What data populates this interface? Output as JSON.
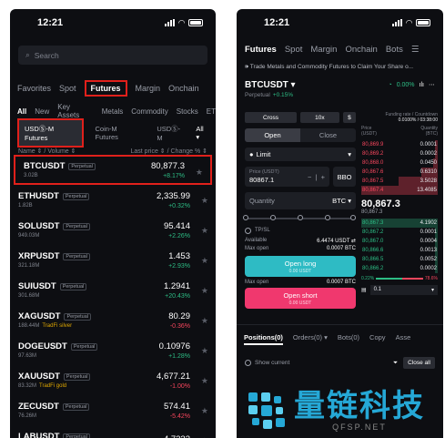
{
  "left": {
    "time": "12:21",
    "search_placeholder": "Search",
    "tabs": [
      "Favorites",
      "Spot",
      "Futures",
      "Margin",
      "Onchain"
    ],
    "subtabs": [
      "All",
      "New",
      "Key Assets",
      "Metals",
      "Commodity",
      "Stocks",
      "ET"
    ],
    "chips": [
      "USDⓈ-M Futures",
      "Coin-M Futures",
      "USDⓈ-M"
    ],
    "chips_all": "All ▾",
    "col_name": "Name ⇕ / Volume ⇕",
    "col_price": "Last price ⇕ / Change % ⇕",
    "rows": [
      {
        "symbol": "BTCUSDT",
        "tag": "Perpetual",
        "volume": "3.02B",
        "extra": "",
        "price": "80,877.3",
        "change": "+8.17%",
        "dir": "up"
      },
      {
        "symbol": "ETHUSDT",
        "tag": "Perpetual",
        "volume": "1.82B",
        "extra": "",
        "price": "2,335.99",
        "change": "+0.32%",
        "dir": "up"
      },
      {
        "symbol": "SOLUSDT",
        "tag": "Perpetual",
        "volume": "949.03M",
        "extra": "",
        "price": "95.414",
        "change": "+2.26%",
        "dir": "up"
      },
      {
        "symbol": "XRPUSDT",
        "tag": "Perpetual",
        "volume": "321.18M",
        "extra": "",
        "price": "1.453",
        "change": "+2.93%",
        "dir": "up"
      },
      {
        "symbol": "SUIUSDT",
        "tag": "Perpetual",
        "volume": "301.68M",
        "extra": "",
        "price": "1.2941",
        "change": "+20.43%",
        "dir": "up"
      },
      {
        "symbol": "XAGUSDT",
        "tag": "Perpetual",
        "volume": "188.44M",
        "extra": "TradFi silver",
        "price": "80.29",
        "change": "-0.36%",
        "dir": "dn"
      },
      {
        "symbol": "DOGEUSDT",
        "tag": "Perpetual",
        "volume": "97.63M",
        "extra": "",
        "price": "0.10976",
        "change": "+1.28%",
        "dir": "up"
      },
      {
        "symbol": "XAUUSDT",
        "tag": "Perpetual",
        "volume": "83.32M",
        "extra": "TradFi gold",
        "price": "4,677.21",
        "change": "-1.00%",
        "dir": "dn"
      },
      {
        "symbol": "ZECUSDT",
        "tag": "Perpetual",
        "volume": "76.26M",
        "extra": "",
        "price": "574.41",
        "change": "-5.42%",
        "dir": "dn"
      },
      {
        "symbol": "LABUSDT",
        "tag": "Perpetual",
        "volume": "",
        "extra": "",
        "price": "4.7223",
        "change": "",
        "dir": "up"
      }
    ]
  },
  "right": {
    "time": "12:21",
    "tabs": [
      "Futures",
      "Spot",
      "Margin",
      "Onchain",
      "Bots"
    ],
    "banner": "Trade Metals and Commodity Futures to Claim Your Share o...",
    "symbol": "BTCUSDT ▾",
    "symbol_sub": "Perpetual",
    "symbol_change": "+0.15%",
    "pct": "0.00%",
    "margin_mode": "Cross",
    "leverage": "10x",
    "asset": "$",
    "open_label": "Open",
    "close_label": "Close",
    "order_type": "Limit",
    "price_label": "Price (USDT)",
    "price_value": "80867.1",
    "bbo": "BBO",
    "qty_label": "Quantity",
    "qty_unit": "BTC ▾",
    "tpsl": "TP/SL",
    "available_label": "Available",
    "available_value": "6.4474 USDT ⇄",
    "maxopen_label": "Max open",
    "maxopen_value": "0.0007 BTC",
    "maxopen2_value": "0.0007 BTC",
    "long_label": "Open long",
    "long_sub": "0.00 USDT",
    "short_label": "Open short",
    "short_sub": "0.00 USDT",
    "funding_label": "Funding rate / Countdown",
    "funding_value": "0.0100% / 03:38:00",
    "book_price_hdr": "Price (USDT)",
    "book_qty_hdr": "Quantity (BTC)",
    "asks": [
      {
        "p": "80,869.9",
        "q": "0.0001"
      },
      {
        "p": "80,869.2",
        "q": "0.0002"
      },
      {
        "p": "80,868.0",
        "q": "0.0450"
      },
      {
        "p": "80,867.6",
        "q": "0.6310"
      },
      {
        "p": "80,867.5",
        "q": "3.5028"
      },
      {
        "p": "80,867.4",
        "q": "13.4085"
      }
    ],
    "mid_price": "80,867.3",
    "mid_sub": "80,867.3",
    "bids": [
      {
        "p": "80,867.3",
        "q": "4.1902"
      },
      {
        "p": "80,867.2",
        "q": "0.0001"
      },
      {
        "p": "80,867.0",
        "q": "0.0004"
      },
      {
        "p": "80,866.6",
        "q": "0.0013"
      },
      {
        "p": "80,866.5",
        "q": "0.0052"
      },
      {
        "p": "80,866.2",
        "q": "0.0002"
      }
    ],
    "buy_ratio": "0.22%",
    "sell_ratio": "78.6%",
    "step": "0.1",
    "bottom_tabs": [
      "Positions(0)",
      "Orders(0) ▾",
      "Bots(0)",
      "Copy",
      "Asse"
    ],
    "show_current": "Show current",
    "close_all": "Close all"
  },
  "watermark": {
    "cn": "量链科技",
    "url": "QFSP.NET"
  },
  "colors": {
    "bg": "#0d0e12",
    "up": "#2dbd85",
    "down": "#f6465d",
    "long": "#2ebbc4",
    "short": "#f0386e",
    "highlight": "#e0201b"
  }
}
